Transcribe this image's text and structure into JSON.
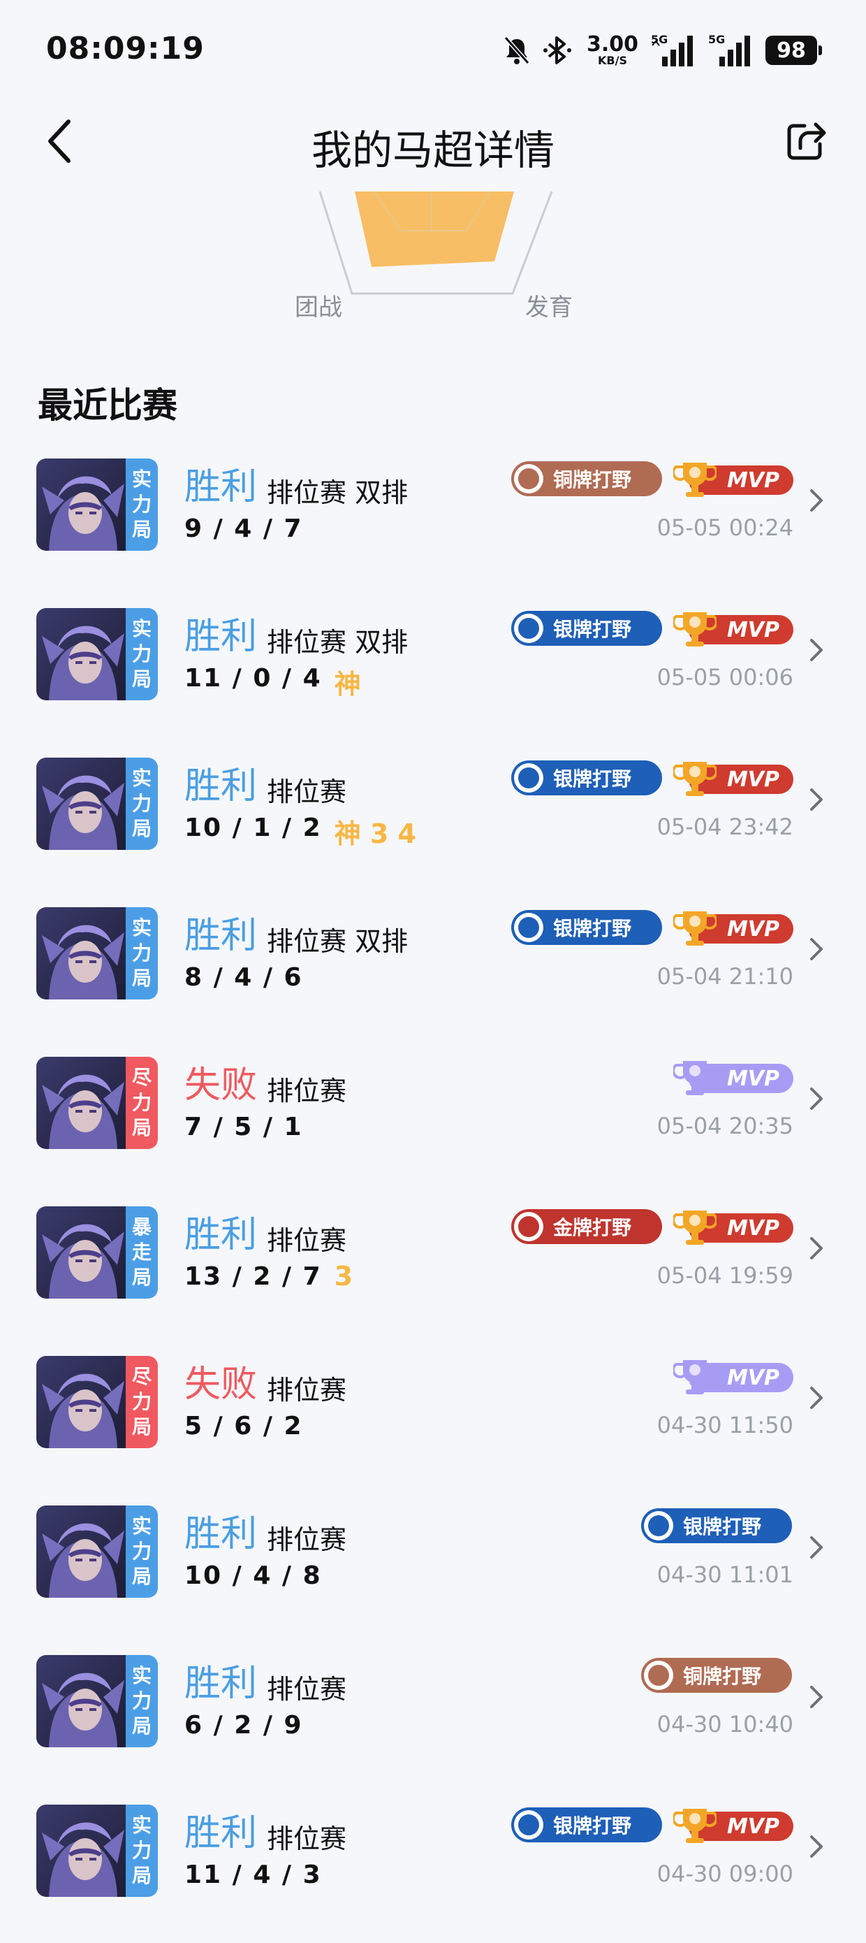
{
  "status_bar": {
    "time": "08:09:19",
    "net_speed": "3.00",
    "net_unit": "KB/S",
    "sig1_tag": "5G",
    "sig2_tag": "5G",
    "battery": "98"
  },
  "header": {
    "title": "我的马超详情"
  },
  "radar": {
    "label_left": "团战",
    "label_right": "发育"
  },
  "section": {
    "title": "最近比赛"
  },
  "colors": {
    "win": "#4a9ee3",
    "lose": "#ee5a5f",
    "accent_gold": "#f8b744",
    "mvp_red": "#cf3b2f",
    "mvp_purple": "#a79cf4"
  },
  "matches": [
    {
      "tier_label": [
        "实",
        "力",
        "局"
      ],
      "tier_color": "blue",
      "result": "胜利",
      "result_type": "win",
      "mode": "排位赛 双排",
      "kda": "9 / 4 / 7",
      "extra": "",
      "badge": "铜牌打野",
      "badge_type": "bronze",
      "mvp": "MVP",
      "mvp_type": "red",
      "time": "05-05 00:24"
    },
    {
      "tier_label": [
        "实",
        "力",
        "局"
      ],
      "tier_color": "blue",
      "result": "胜利",
      "result_type": "win",
      "mode": "排位赛 双排",
      "kda": "11 / 0 / 4",
      "extra": "神",
      "badge": "银牌打野",
      "badge_type": "silver",
      "mvp": "MVP",
      "mvp_type": "red",
      "time": "05-05 00:06"
    },
    {
      "tier_label": [
        "实",
        "力",
        "局"
      ],
      "tier_color": "blue",
      "result": "胜利",
      "result_type": "win",
      "mode": "排位赛",
      "kda": "10 / 1 / 2",
      "extra": "神 3 4",
      "badge": "银牌打野",
      "badge_type": "silver",
      "mvp": "MVP",
      "mvp_type": "red",
      "time": "05-04 23:42"
    },
    {
      "tier_label": [
        "实",
        "力",
        "局"
      ],
      "tier_color": "blue",
      "result": "胜利",
      "result_type": "win",
      "mode": "排位赛 双排",
      "kda": "8 / 4 / 6",
      "extra": "",
      "badge": "银牌打野",
      "badge_type": "silver",
      "mvp": "MVP",
      "mvp_type": "red",
      "time": "05-04 21:10"
    },
    {
      "tier_label": [
        "尽",
        "力",
        "局"
      ],
      "tier_color": "red",
      "result": "失败",
      "result_type": "lose",
      "mode": "排位赛",
      "kda": "7 / 5 / 1",
      "extra": "",
      "badge": "",
      "badge_type": "",
      "mvp": "MVP",
      "mvp_type": "purple",
      "time": "05-04 20:35"
    },
    {
      "tier_label": [
        "暴",
        "走",
        "局"
      ],
      "tier_color": "blue",
      "result": "胜利",
      "result_type": "win",
      "mode": "排位赛",
      "kda": "13 / 2 / 7",
      "extra": "3",
      "badge": "金牌打野",
      "badge_type": "gold",
      "mvp": "MVP",
      "mvp_type": "red",
      "time": "05-04 19:59"
    },
    {
      "tier_label": [
        "尽",
        "力",
        "局"
      ],
      "tier_color": "red",
      "result": "失败",
      "result_type": "lose",
      "mode": "排位赛",
      "kda": "5 / 6 / 2",
      "extra": "",
      "badge": "",
      "badge_type": "",
      "mvp": "MVP",
      "mvp_type": "purple",
      "time": "04-30 11:50"
    },
    {
      "tier_label": [
        "实",
        "力",
        "局"
      ],
      "tier_color": "blue",
      "result": "胜利",
      "result_type": "win",
      "mode": "排位赛",
      "kda": "10 / 4 / 8",
      "extra": "",
      "badge": "银牌打野",
      "badge_type": "silver",
      "mvp": "",
      "mvp_type": "",
      "time": "04-30 11:01"
    },
    {
      "tier_label": [
        "实",
        "力",
        "局"
      ],
      "tier_color": "blue",
      "result": "胜利",
      "result_type": "win",
      "mode": "排位赛",
      "kda": "6 / 2 / 9",
      "extra": "",
      "badge": "铜牌打野",
      "badge_type": "bronze",
      "mvp": "",
      "mvp_type": "",
      "time": "04-30 10:40"
    },
    {
      "tier_label": [
        "实",
        "力",
        "局"
      ],
      "tier_color": "blue",
      "result": "胜利",
      "result_type": "win",
      "mode": "排位赛",
      "kda": "11 / 4 / 3",
      "extra": "",
      "badge": "银牌打野",
      "badge_type": "silver",
      "mvp": "MVP",
      "mvp_type": "red",
      "time": "04-30 09:00"
    }
  ]
}
